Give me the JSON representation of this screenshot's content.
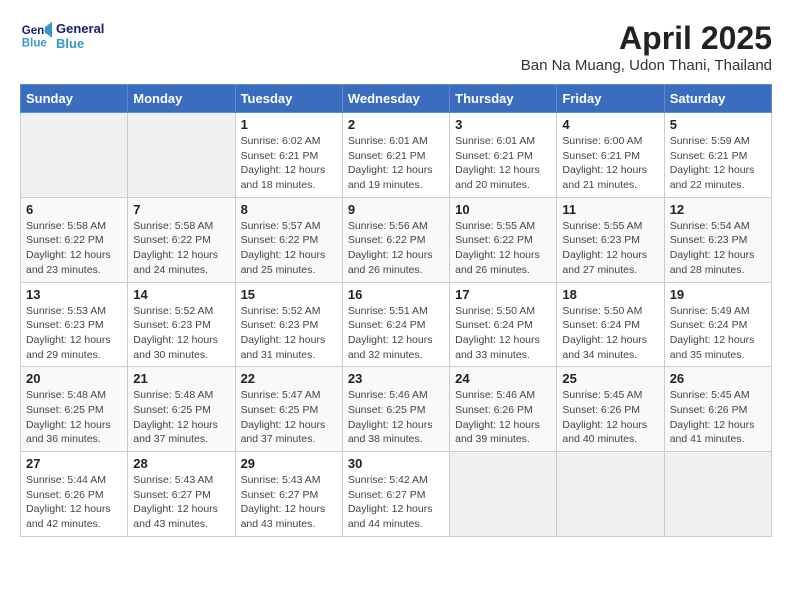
{
  "logo": {
    "line1": "General",
    "line2": "Blue"
  },
  "title": "April 2025",
  "subtitle": "Ban Na Muang, Udon Thani, Thailand",
  "headers": [
    "Sunday",
    "Monday",
    "Tuesday",
    "Wednesday",
    "Thursday",
    "Friday",
    "Saturday"
  ],
  "weeks": [
    [
      {
        "day": "",
        "info": ""
      },
      {
        "day": "",
        "info": ""
      },
      {
        "day": "1",
        "info": "Sunrise: 6:02 AM\nSunset: 6:21 PM\nDaylight: 12 hours and 18 minutes."
      },
      {
        "day": "2",
        "info": "Sunrise: 6:01 AM\nSunset: 6:21 PM\nDaylight: 12 hours and 19 minutes."
      },
      {
        "day": "3",
        "info": "Sunrise: 6:01 AM\nSunset: 6:21 PM\nDaylight: 12 hours and 20 minutes."
      },
      {
        "day": "4",
        "info": "Sunrise: 6:00 AM\nSunset: 6:21 PM\nDaylight: 12 hours and 21 minutes."
      },
      {
        "day": "5",
        "info": "Sunrise: 5:59 AM\nSunset: 6:21 PM\nDaylight: 12 hours and 22 minutes."
      }
    ],
    [
      {
        "day": "6",
        "info": "Sunrise: 5:58 AM\nSunset: 6:22 PM\nDaylight: 12 hours and 23 minutes."
      },
      {
        "day": "7",
        "info": "Sunrise: 5:58 AM\nSunset: 6:22 PM\nDaylight: 12 hours and 24 minutes."
      },
      {
        "day": "8",
        "info": "Sunrise: 5:57 AM\nSunset: 6:22 PM\nDaylight: 12 hours and 25 minutes."
      },
      {
        "day": "9",
        "info": "Sunrise: 5:56 AM\nSunset: 6:22 PM\nDaylight: 12 hours and 26 minutes."
      },
      {
        "day": "10",
        "info": "Sunrise: 5:55 AM\nSunset: 6:22 PM\nDaylight: 12 hours and 26 minutes."
      },
      {
        "day": "11",
        "info": "Sunrise: 5:55 AM\nSunset: 6:23 PM\nDaylight: 12 hours and 27 minutes."
      },
      {
        "day": "12",
        "info": "Sunrise: 5:54 AM\nSunset: 6:23 PM\nDaylight: 12 hours and 28 minutes."
      }
    ],
    [
      {
        "day": "13",
        "info": "Sunrise: 5:53 AM\nSunset: 6:23 PM\nDaylight: 12 hours and 29 minutes."
      },
      {
        "day": "14",
        "info": "Sunrise: 5:52 AM\nSunset: 6:23 PM\nDaylight: 12 hours and 30 minutes."
      },
      {
        "day": "15",
        "info": "Sunrise: 5:52 AM\nSunset: 6:23 PM\nDaylight: 12 hours and 31 minutes."
      },
      {
        "day": "16",
        "info": "Sunrise: 5:51 AM\nSunset: 6:24 PM\nDaylight: 12 hours and 32 minutes."
      },
      {
        "day": "17",
        "info": "Sunrise: 5:50 AM\nSunset: 6:24 PM\nDaylight: 12 hours and 33 minutes."
      },
      {
        "day": "18",
        "info": "Sunrise: 5:50 AM\nSunset: 6:24 PM\nDaylight: 12 hours and 34 minutes."
      },
      {
        "day": "19",
        "info": "Sunrise: 5:49 AM\nSunset: 6:24 PM\nDaylight: 12 hours and 35 minutes."
      }
    ],
    [
      {
        "day": "20",
        "info": "Sunrise: 5:48 AM\nSunset: 6:25 PM\nDaylight: 12 hours and 36 minutes."
      },
      {
        "day": "21",
        "info": "Sunrise: 5:48 AM\nSunset: 6:25 PM\nDaylight: 12 hours and 37 minutes."
      },
      {
        "day": "22",
        "info": "Sunrise: 5:47 AM\nSunset: 6:25 PM\nDaylight: 12 hours and 37 minutes."
      },
      {
        "day": "23",
        "info": "Sunrise: 5:46 AM\nSunset: 6:25 PM\nDaylight: 12 hours and 38 minutes."
      },
      {
        "day": "24",
        "info": "Sunrise: 5:46 AM\nSunset: 6:26 PM\nDaylight: 12 hours and 39 minutes."
      },
      {
        "day": "25",
        "info": "Sunrise: 5:45 AM\nSunset: 6:26 PM\nDaylight: 12 hours and 40 minutes."
      },
      {
        "day": "26",
        "info": "Sunrise: 5:45 AM\nSunset: 6:26 PM\nDaylight: 12 hours and 41 minutes."
      }
    ],
    [
      {
        "day": "27",
        "info": "Sunrise: 5:44 AM\nSunset: 6:26 PM\nDaylight: 12 hours and 42 minutes."
      },
      {
        "day": "28",
        "info": "Sunrise: 5:43 AM\nSunset: 6:27 PM\nDaylight: 12 hours and 43 minutes."
      },
      {
        "day": "29",
        "info": "Sunrise: 5:43 AM\nSunset: 6:27 PM\nDaylight: 12 hours and 43 minutes."
      },
      {
        "day": "30",
        "info": "Sunrise: 5:42 AM\nSunset: 6:27 PM\nDaylight: 12 hours and 44 minutes."
      },
      {
        "day": "",
        "info": ""
      },
      {
        "day": "",
        "info": ""
      },
      {
        "day": "",
        "info": ""
      }
    ]
  ]
}
